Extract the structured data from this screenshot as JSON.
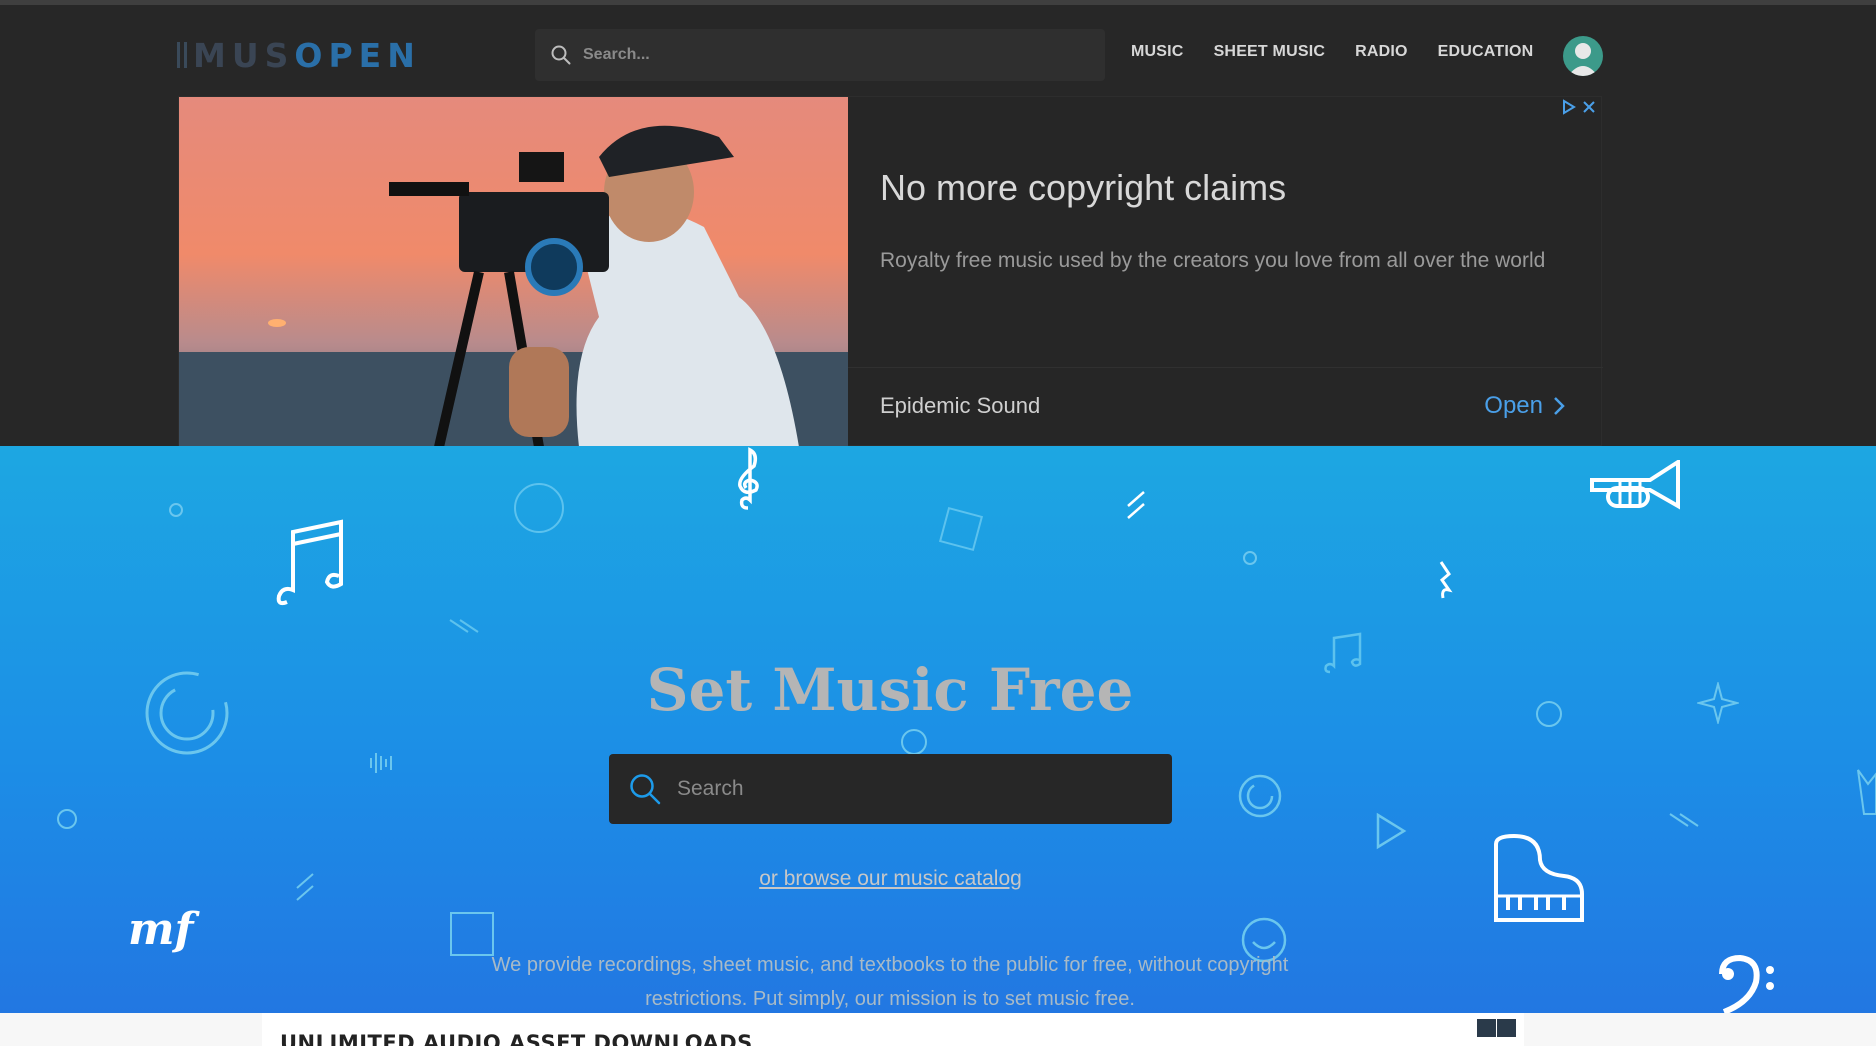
{
  "header": {
    "logo_prefix": "MUS",
    "logo_suffix": "OPEN",
    "search_placeholder": "Search...",
    "nav": [
      "MUSIC",
      "SHEET MUSIC",
      "RADIO",
      "EDUCATION"
    ]
  },
  "ad": {
    "title": "No more copyright claims",
    "description": "Royalty free music used by the creators you love from all over the world",
    "brand": "Epidemic Sound",
    "cta": "Open"
  },
  "hero": {
    "title": "Set Music Free",
    "search_placeholder": "Search",
    "browse_link": "or browse our music catalog",
    "mission": "We provide recordings, sheet music, and textbooks to the public for free, without copyright restrictions. Put simply, our mission is to set music free."
  },
  "bottom_ad": {
    "text": "UNLIMITED AUDIO ASSET DOWNLOADS"
  },
  "colors": {
    "header_bg": "#272727",
    "logo_accent": "#2a6fa8",
    "hero_top": "#1da7e2",
    "hero_bottom": "#2277e2",
    "ad_cta": "#4a9fe8"
  }
}
